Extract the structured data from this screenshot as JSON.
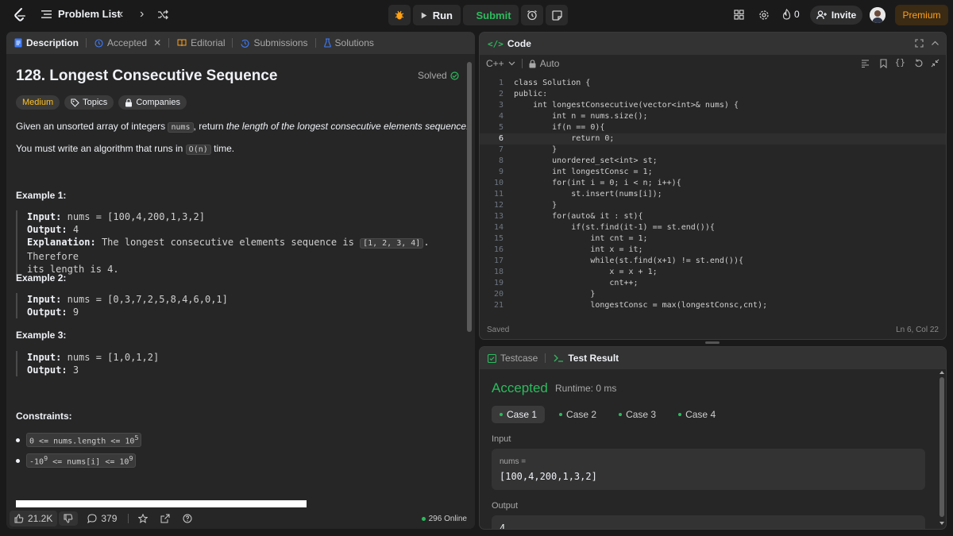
{
  "topbar": {
    "problem_list": "Problem List",
    "run": "Run",
    "submit": "Submit",
    "streak": "0",
    "invite": "Invite",
    "premium": "Premium"
  },
  "left": {
    "tabs": [
      {
        "label": "Description"
      },
      {
        "label": "Accepted"
      },
      {
        "label": "Editorial"
      },
      {
        "label": "Submissions"
      },
      {
        "label": "Solutions"
      }
    ],
    "title": "128. Longest Consecutive Sequence",
    "solved": "Solved",
    "chips": {
      "difficulty": "Medium",
      "topics": "Topics",
      "companies": "Companies"
    },
    "desc1_pre": "Given an unsorted array of integers",
    "desc1_code": "nums",
    "desc1_mid": ", return",
    "desc1_em": "the length of the longest consecutive elements sequence.",
    "desc2_pre": "You must write an algorithm that runs in",
    "desc2_code": "O(n)",
    "desc2_post": "time.",
    "examples": [
      {
        "title": "Example 1:",
        "input": "nums = [100,4,200,1,3,2]",
        "output": "4",
        "explanation_pre": "The longest consecutive elements sequence is",
        "explanation_code": "[1, 2, 3, 4]",
        "explanation_post": ". Therefore",
        "explanation_line2": "its length is 4."
      },
      {
        "title": "Example 2:",
        "input": "nums = [0,3,7,2,5,8,4,6,0,1]",
        "output": "9"
      },
      {
        "title": "Example 3:",
        "input": "nums = [1,0,1,2]",
        "output": "3"
      }
    ],
    "labels": {
      "input": "Input:",
      "output": "Output:",
      "explanation": "Explanation:"
    },
    "constraints_title": "Constraints:",
    "constraints": [
      {
        "text": "0 <= nums.length <= 10",
        "sup": "5"
      },
      {
        "text_pre": "-10",
        "sup_pre": "9",
        "text_mid": " <= nums[i] <= 10",
        "sup": "9"
      }
    ],
    "bottom": {
      "likes": "21.2K",
      "comments": "379",
      "online": "296 Online"
    }
  },
  "code": {
    "title": "Code",
    "lang": "C++",
    "mode": "Auto",
    "current_line": 6,
    "lines": [
      "class Solution {",
      "public:",
      "    int longestConsecutive(vector<int>& nums) {",
      "        int n = nums.size();",
      "        if(n == 0){",
      "            return 0;",
      "        }",
      "        unordered_set<int> st;",
      "        int longestConsc = 1;",
      "        for(int i = 0; i < n; i++){",
      "            st.insert(nums[i]);",
      "        }",
      "        for(auto& it : st){",
      "            if(st.find(it-1) == st.end()){",
      "                int cnt = 1;",
      "                int x = it;",
      "                while(st.find(x+1) != st.end()){",
      "                    x = x + 1;",
      "                    cnt++;",
      "                }",
      "                longestConsc = max(longestConsc,cnt);"
    ],
    "saved": "Saved",
    "cursor": "Ln 6, Col 22"
  },
  "test": {
    "tabs": [
      {
        "label": "Testcase"
      },
      {
        "label": "Test Result"
      }
    ],
    "status": "Accepted",
    "runtime": "Runtime: 0 ms",
    "cases": [
      "Case 1",
      "Case 2",
      "Case 3",
      "Case 4"
    ],
    "input_label": "Input",
    "input_var": "nums =",
    "input_value": "[100,4,200,1,3,2]",
    "output_label": "Output",
    "output_value": "4"
  },
  "colors": {
    "accent_green": "#2cbb5d",
    "premium": "#ffa116",
    "medium": "#ffc01e"
  }
}
